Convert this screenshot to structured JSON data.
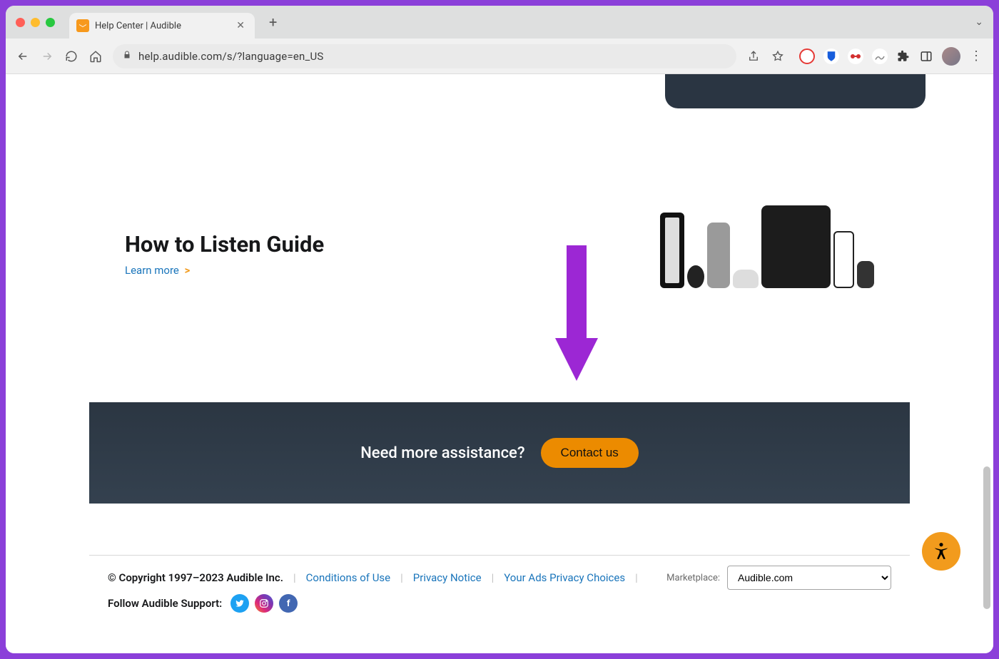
{
  "tab": {
    "title": "Help Center | Audible"
  },
  "url": "help.audible.com/s/?language=en_US",
  "guide": {
    "heading": "How to Listen Guide",
    "learn_more": "Learn more",
    "caret": ">"
  },
  "cta": {
    "prompt": "Need more assistance?",
    "button": "Contact us"
  },
  "footer": {
    "copyright": "© Copyright 1997–2023 Audible Inc.",
    "links": {
      "conditions": "Conditions of Use",
      "privacy": "Privacy Notice",
      "ads": "Your Ads Privacy Choices"
    },
    "follow_label": "Follow Audible Support:",
    "marketplace_label": "Marketplace:",
    "marketplace_value": "Audible.com"
  },
  "colors": {
    "accent": "#f29b1d",
    "link": "#1a75bb",
    "dark": "#2b3642",
    "annotation": "#9c27d4"
  }
}
